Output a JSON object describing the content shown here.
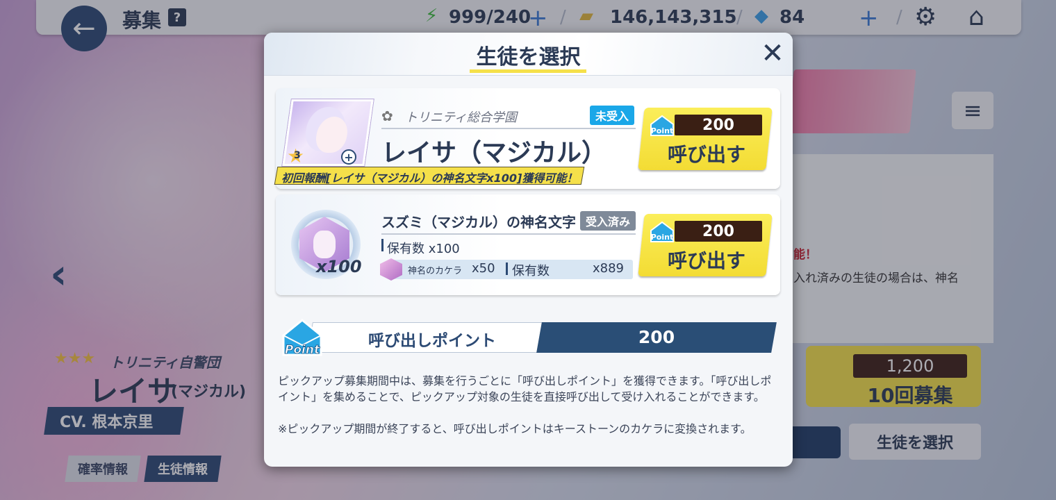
{
  "topbar": {
    "back_icon": "←",
    "title": "募集",
    "help": "?",
    "ap": "999/240",
    "credits": "146,143,315",
    "gems": "84",
    "plus": "+",
    "gear_icon": "⚙",
    "home_icon": "⌂"
  },
  "background": {
    "arrow_left": "‹",
    "arrow_right": "›",
    "menu_icon": "≡",
    "warn_text": "能！",
    "note_text": "入れ済みの生徒の場合は、神名",
    "student_stars": "★★★",
    "student_school": "トリニティ自警団",
    "student_name": "レイサ",
    "student_name_sub": "(マジカル)",
    "cv": "CV. 根本京里",
    "tab_rate": "確率情報",
    "tab_student": "生徒情報",
    "recruit10_cost": "1,200",
    "recruit10_label": "10回募集",
    "select_student": "生徒を選択"
  },
  "modal": {
    "title": "生徒を選択",
    "close_icon": "✕",
    "card1": {
      "school": "トリニティ総合学園",
      "status_tag": "未受入",
      "name": "レイサ（マジカル）",
      "star_level": "3",
      "reward": "初回報酬[レイサ（マジカル）の神名文字x100]獲得可能！",
      "cost": "200",
      "point_label": "Point",
      "button_label": "呼び出す"
    },
    "card2": {
      "item_name": "スズミ（マジカル）の神名文字",
      "status_tag": "受入済み",
      "quantity": "x100",
      "owned": "保有数 x100",
      "karera_label": "神名のカケラ",
      "karera_qty": "x50",
      "karera_owned_label": "保有数",
      "karera_owned": "x889",
      "cost": "200",
      "point_label": "Point",
      "button_label": "呼び出す"
    },
    "points": {
      "icon_label": "Point",
      "label": "呼び出しポイント",
      "value": "200"
    },
    "description": "ピックアップ募集期間中は、募集を行うごとに「呼び出しポイント」を獲得できます。「呼び出しポイント」を集めることで、ピックアップ対象の生徒を直接呼び出して受け入れることができます。",
    "note": "※ピックアップ期間が終了すると、呼び出しポイントはキーストーンのカケラに変換されます。"
  },
  "colors": {
    "navy": "#2b3a55",
    "accent_yellow": "#f5e04a",
    "tag_blue": "#1aa7e8",
    "tag_gray": "#7f8a99",
    "cost_brown": "#3a1f14"
  }
}
